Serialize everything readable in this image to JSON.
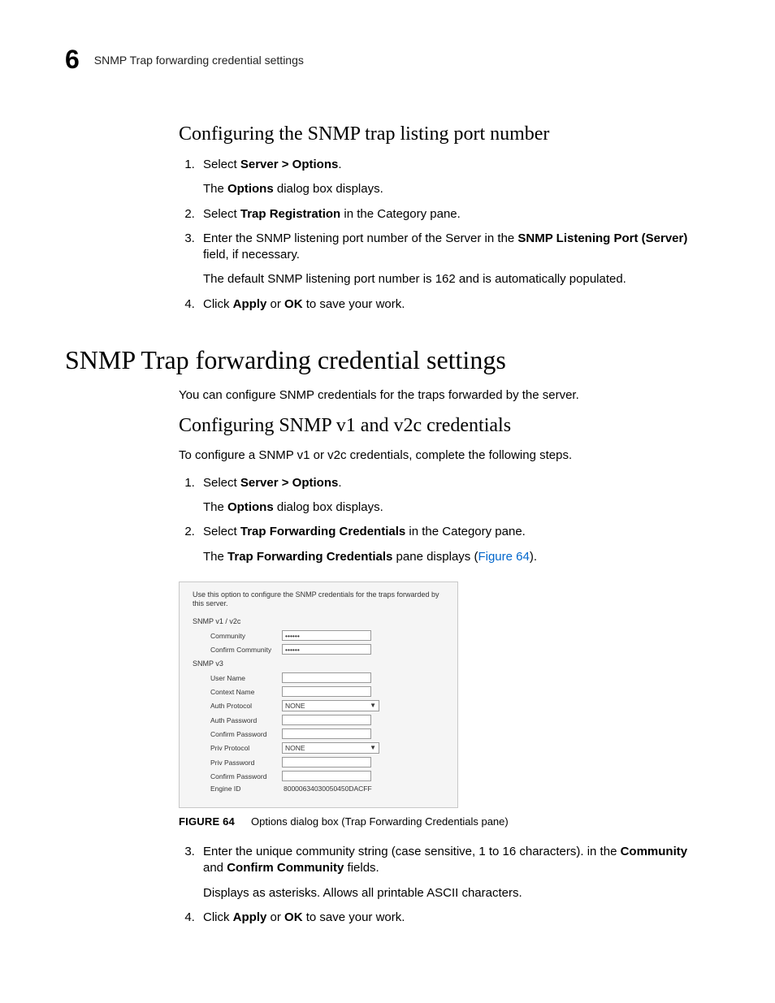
{
  "header": {
    "chapter_number": "6",
    "title": "SNMP Trap forwarding credential settings"
  },
  "section1": {
    "heading": "Configuring the SNMP trap listing port number",
    "steps": [
      {
        "pre": "Select ",
        "bold": "Server > Options",
        "post": ".",
        "sub_pre": "The ",
        "sub_bold": "Options",
        "sub_post": " dialog box displays."
      },
      {
        "pre": "Select ",
        "bold": "Trap Registration",
        "post": " in the Category pane."
      },
      {
        "pre": "Enter the SNMP listening port number of the Server in the ",
        "bold": "SNMP Listening Port (Server)",
        "post": " field, if necessary.",
        "sub_plain": "The default SNMP listening port number is 162 and is automatically populated."
      },
      {
        "pre": "Click ",
        "bold": "Apply",
        "mid": " or ",
        "bold2": "OK",
        "post": " to save your work."
      }
    ]
  },
  "section2": {
    "heading": "SNMP Trap forwarding credential settings",
    "intro": "You can configure SNMP credentials for the traps forwarded by the server."
  },
  "section3": {
    "heading": "Configuring SNMP v1 and v2c credentials",
    "intro": "To configure a SNMP v1 or v2c credentials, complete the following steps.",
    "steps": [
      {
        "pre": "Select ",
        "bold": "Server > Options",
        "post": ".",
        "sub_pre": "The ",
        "sub_bold": "Options",
        "sub_post": " dialog box displays."
      },
      {
        "pre": "Select ",
        "bold": "Trap Forwarding Credentials",
        "post": " in the Category pane.",
        "sub_pre": "The ",
        "sub_bold": "Trap Forwarding Credentials",
        "sub_post": " pane displays (",
        "sub_link": "Figure 64",
        "sub_tail": ")."
      }
    ],
    "steps_after": [
      {
        "text1": "Enter the unique community string (case sensitive, 1 to 16 characters). in the ",
        "bold1": "Community",
        "mid": " and ",
        "bold2": "Confirm Community",
        "post": " fields.",
        "sub_plain": "Displays as asterisks. Allows all printable ASCII characters."
      },
      {
        "pre": "Click ",
        "bold": "Apply",
        "mid": " or ",
        "bold2": "OK",
        "post": " to save your work."
      }
    ]
  },
  "dialog": {
    "caption": "Use this option to configure the SNMP credentials for the traps forwarded by this server.",
    "group1": "SNMP v1 / v2c",
    "community_label": "Community",
    "community_value": "••••••",
    "confirm_community_label": "Confirm Community",
    "confirm_community_value": "••••••",
    "group2": "SNMP v3",
    "user_name_label": "User Name",
    "context_name_label": "Context Name",
    "auth_protocol_label": "Auth Protocol",
    "auth_protocol_value": "NONE",
    "auth_password_label": "Auth Password",
    "confirm_password_label": "Confirm Password",
    "priv_protocol_label": "Priv Protocol",
    "priv_protocol_value": "NONE",
    "priv_password_label": "Priv Password",
    "confirm_password2_label": "Confirm Password",
    "engine_id_label": "Engine ID",
    "engine_id_value": "80000634030050450DACFF"
  },
  "figure": {
    "label": "FIGURE 64",
    "text": "Options dialog box (Trap Forwarding Credentials pane)"
  }
}
